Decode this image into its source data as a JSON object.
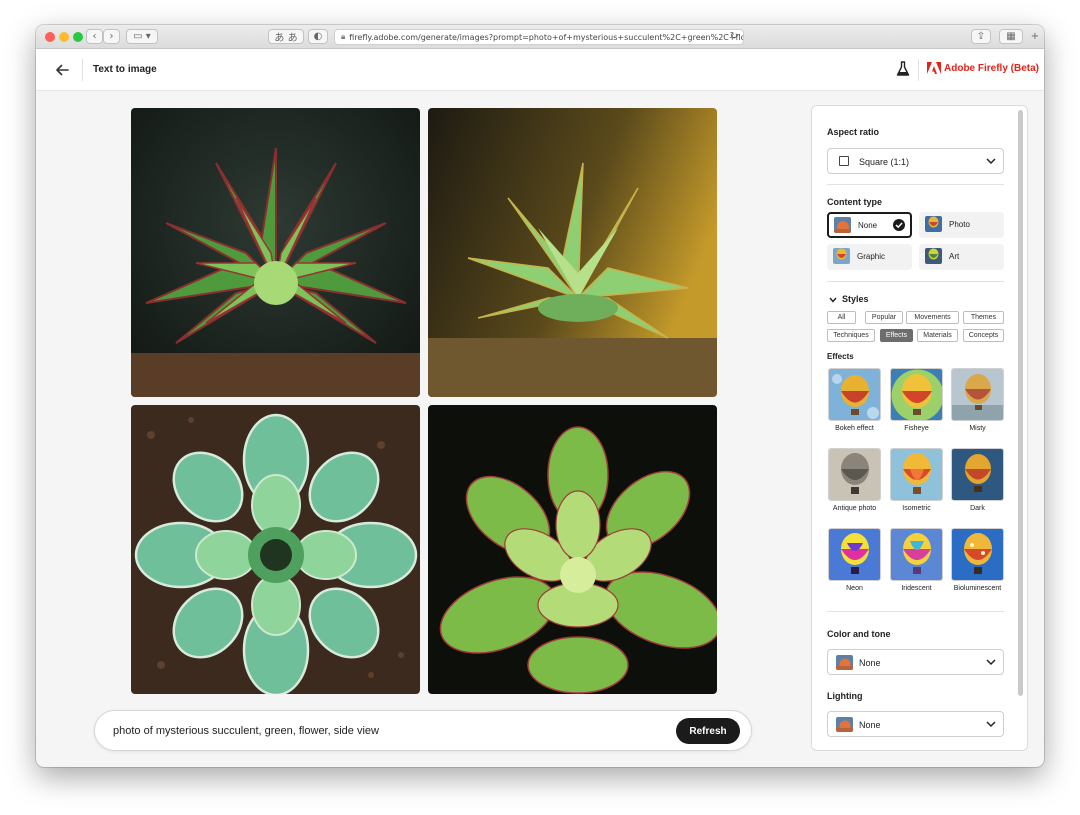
{
  "browser": {
    "url": "firefly.adobe.com/generate/images?prompt=photo+of+mysterious+succulent%2C+green%2C+flowe..."
  },
  "header": {
    "title": "Text to image",
    "brand": "Adobe Firefly (Beta)"
  },
  "prompt": {
    "text": "photo of mysterious succulent, green, flower, side view",
    "refresh_label": "Refresh"
  },
  "panel": {
    "aspect_ratio": {
      "title": "Aspect ratio",
      "value": "Square (1:1)"
    },
    "content_type": {
      "title": "Content type",
      "options": [
        {
          "label": "None",
          "selected": true
        },
        {
          "label": "Photo",
          "selected": false
        },
        {
          "label": "Graphic",
          "selected": false
        },
        {
          "label": "Art",
          "selected": false
        }
      ]
    },
    "styles": {
      "title": "Styles",
      "chips": [
        "All",
        "Popular",
        "Movements",
        "Themes",
        "Techniques",
        "Effects",
        "Materials",
        "Concepts"
      ],
      "active_chip": "Effects",
      "section_title": "Effects",
      "effects": [
        "Bokeh effect",
        "Fisheye",
        "Misty",
        "Antique photo",
        "Isometric",
        "Dark",
        "Neon",
        "Iridescent",
        "Bioluminescent"
      ]
    },
    "color_tone": {
      "title": "Color and tone",
      "value": "None"
    },
    "lighting": {
      "title": "Lighting",
      "value": "None"
    }
  },
  "colors": {
    "brand_red": "#e1251b",
    "accent_dark": "#1b1b1b"
  }
}
